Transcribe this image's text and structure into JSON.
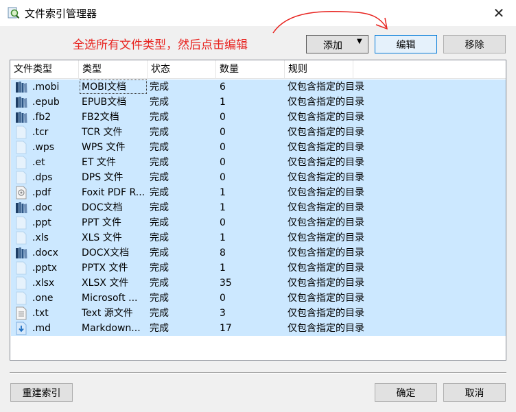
{
  "window": {
    "title": "文件索引管理器",
    "close_glyph": "✕"
  },
  "annotation": {
    "instruction": "全选所有文件类型，然后点击编辑",
    "color": "#e8231f"
  },
  "toolbar": {
    "add_label": "添加",
    "add_caret": "▼",
    "edit_label": "编辑",
    "remove_label": "移除"
  },
  "table": {
    "columns": [
      "文件类型",
      "类型",
      "状态",
      "数量",
      "规则"
    ],
    "rows": [
      {
        "icon": "ebook-books-icon",
        "ext": ".mobi",
        "type": "MOBI文档",
        "status": "完成",
        "count": "6",
        "rule": "仅包含指定的目录"
      },
      {
        "icon": "ebook-books-icon",
        "ext": ".epub",
        "type": "EPUB文档",
        "status": "完成",
        "count": "1",
        "rule": "仅包含指定的目录"
      },
      {
        "icon": "ebook-books-icon",
        "ext": ".fb2",
        "type": "FB2文档",
        "status": "完成",
        "count": "0",
        "rule": "仅包含指定的目录"
      },
      {
        "icon": "blank-file-icon",
        "ext": ".tcr",
        "type": "TCR 文件",
        "status": "完成",
        "count": "0",
        "rule": "仅包含指定的目录"
      },
      {
        "icon": "blank-file-icon",
        "ext": ".wps",
        "type": "WPS 文件",
        "status": "完成",
        "count": "0",
        "rule": "仅包含指定的目录"
      },
      {
        "icon": "blank-file-icon",
        "ext": ".et",
        "type": "ET 文件",
        "status": "完成",
        "count": "0",
        "rule": "仅包含指定的目录"
      },
      {
        "icon": "blank-file-icon",
        "ext": ".dps",
        "type": "DPS 文件",
        "status": "完成",
        "count": "0",
        "rule": "仅包含指定的目录"
      },
      {
        "icon": "pdf-file-icon",
        "ext": ".pdf",
        "type": "Foxit PDF R...",
        "status": "完成",
        "count": "1",
        "rule": "仅包含指定的目录"
      },
      {
        "icon": "ebook-books-icon",
        "ext": ".doc",
        "type": "DOC文档",
        "status": "完成",
        "count": "1",
        "rule": "仅包含指定的目录"
      },
      {
        "icon": "blank-file-icon",
        "ext": ".ppt",
        "type": "PPT 文件",
        "status": "完成",
        "count": "0",
        "rule": "仅包含指定的目录"
      },
      {
        "icon": "blank-file-icon",
        "ext": ".xls",
        "type": "XLS 文件",
        "status": "完成",
        "count": "1",
        "rule": "仅包含指定的目录"
      },
      {
        "icon": "ebook-books-icon",
        "ext": ".docx",
        "type": "DOCX文档",
        "status": "完成",
        "count": "8",
        "rule": "仅包含指定的目录"
      },
      {
        "icon": "blank-file-icon",
        "ext": ".pptx",
        "type": "PPTX 文件",
        "status": "完成",
        "count": "1",
        "rule": "仅包含指定的目录"
      },
      {
        "icon": "blank-file-icon",
        "ext": ".xlsx",
        "type": "XLSX 文件",
        "status": "完成",
        "count": "35",
        "rule": "仅包含指定的目录"
      },
      {
        "icon": "blank-file-icon",
        "ext": ".one",
        "type": "Microsoft ...",
        "status": "完成",
        "count": "0",
        "rule": "仅包含指定的目录"
      },
      {
        "icon": "text-file-icon",
        "ext": ".txt",
        "type": "Text 源文件",
        "status": "完成",
        "count": "3",
        "rule": "仅包含指定的目录"
      },
      {
        "icon": "markdown-file-icon",
        "ext": ".md",
        "type": "Markdown...",
        "status": "完成",
        "count": "17",
        "rule": "仅包含指定的目录"
      }
    ]
  },
  "footer": {
    "rebuild_label": "重建索引",
    "ok_label": "确定",
    "cancel_label": "取消"
  },
  "colors": {
    "selection": "#cce8ff",
    "focus_border": "#0078d7"
  }
}
